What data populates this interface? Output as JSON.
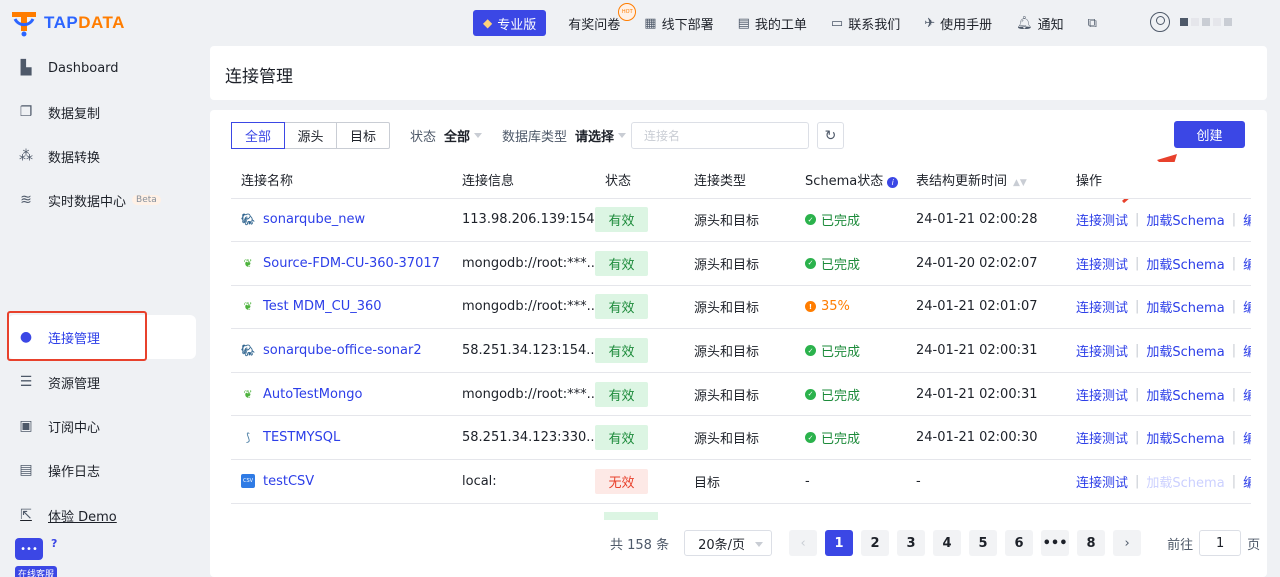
{
  "app": {
    "logo_text_a": "TAP",
    "logo_text_b": "DATA"
  },
  "topnav": {
    "pro": "专业版",
    "hot_badge": "HOT",
    "items": [
      {
        "label": "有奖问卷",
        "icon": "survey-icon"
      },
      {
        "label": "线下部署",
        "icon": "deploy-icon"
      },
      {
        "label": "我的工单",
        "icon": "ticket-icon"
      },
      {
        "label": "联系我们",
        "icon": "contact-icon"
      },
      {
        "label": "使用手册",
        "icon": "manual-icon"
      },
      {
        "label": "通知",
        "icon": "bell-icon"
      }
    ],
    "lang_icon": "language-icon"
  },
  "sidebar": {
    "items": [
      {
        "label": "Dashboard"
      },
      {
        "label": "数据复制"
      },
      {
        "label": "数据转换"
      },
      {
        "label": "实时数据中心",
        "badge": "Beta"
      },
      {
        "label": "连接管理"
      },
      {
        "label": "资源管理"
      },
      {
        "label": "订阅中心"
      },
      {
        "label": "操作日志"
      },
      {
        "label": "体验 Demo"
      }
    ],
    "support_label": "在线客服",
    "support_q": "?"
  },
  "page": {
    "title": "连接管理"
  },
  "filters": {
    "tabs": [
      "全部",
      "源头",
      "目标"
    ],
    "status_label": "状态",
    "status_value": "全部",
    "dbtype_label": "数据库类型",
    "dbtype_value": "请选择",
    "search_placeholder": "连接名",
    "create": "创建"
  },
  "table": {
    "headers": [
      "连接名称",
      "连接信息",
      "状态",
      "连接类型",
      "Schema状态",
      "表结构更新时间",
      "操作"
    ],
    "ops": {
      "test": "连接测试",
      "load": "加载Schema",
      "edit": "编辑"
    },
    "rows": [
      {
        "name": "sonarqube_new",
        "db": "pg",
        "info": "113.98.206.139:154...",
        "status": "有效",
        "ok": true,
        "type": "源头和目标",
        "schema": "已完成",
        "schema_state": "done",
        "time": "24-01-21 02:00:28"
      },
      {
        "name": "Source-FDM-CU-360-37017",
        "db": "mongo",
        "info": "mongodb://root:***...",
        "status": "有效",
        "ok": true,
        "type": "源头和目标",
        "schema": "已完成",
        "schema_state": "done",
        "time": "24-01-20 02:02:07"
      },
      {
        "name": "Test MDM_CU_360",
        "db": "mongo",
        "info": "mongodb://root:***...",
        "status": "有效",
        "ok": true,
        "type": "源头和目标",
        "schema": "35%",
        "schema_state": "warn",
        "time": "24-01-21 02:01:07"
      },
      {
        "name": "sonarqube-office-sonar2",
        "db": "pg",
        "info": "58.251.34.123:154...",
        "status": "有效",
        "ok": true,
        "type": "源头和目标",
        "schema": "已完成",
        "schema_state": "done",
        "time": "24-01-21 02:00:31"
      },
      {
        "name": "AutoTestMongo",
        "db": "mongo",
        "info": "mongodb://root:***...",
        "status": "有效",
        "ok": true,
        "type": "源头和目标",
        "schema": "已完成",
        "schema_state": "done",
        "time": "24-01-21 02:00:31"
      },
      {
        "name": "TESTMYSQL",
        "db": "mysql",
        "info": "58.251.34.123:330...",
        "status": "有效",
        "ok": true,
        "type": "源头和目标",
        "schema": "已完成",
        "schema_state": "done",
        "time": "24-01-21 02:00:30"
      },
      {
        "name": "testCSV",
        "db": "csv",
        "info": "local:",
        "status": "无效",
        "ok": false,
        "type": "目标",
        "schema": "-",
        "schema_state": "none",
        "time": "-"
      }
    ]
  },
  "pager": {
    "total": "共 158 条",
    "page_size": "20条/页",
    "pages": [
      "1",
      "2",
      "3",
      "4",
      "5",
      "6",
      "•••",
      "8"
    ],
    "current": "1",
    "goto_label": "前往",
    "goto_value": "1",
    "goto_suffix": "页"
  },
  "colors": {
    "primary": "#3b47e5",
    "success": "#1d8b3b",
    "warning": "#ff7d00",
    "danger": "#e8412c"
  }
}
